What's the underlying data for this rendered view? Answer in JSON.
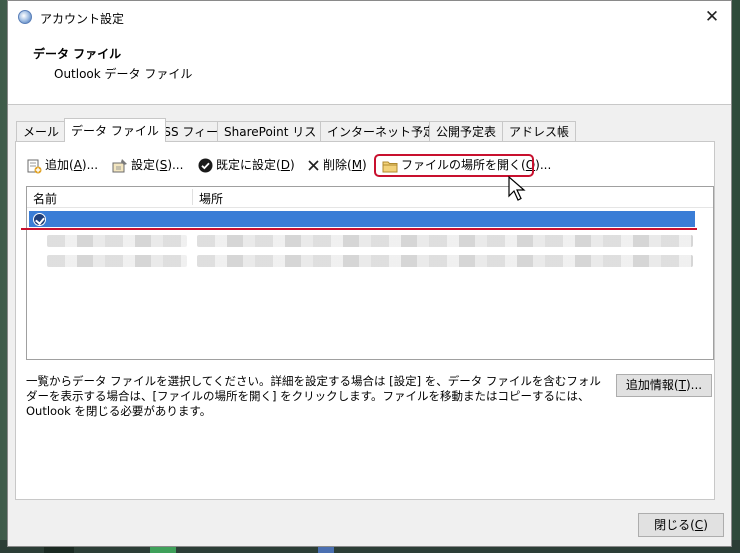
{
  "window": {
    "title": "アカウント設定",
    "close_glyph": "✕"
  },
  "header": {
    "title": "データ ファイル",
    "subtitle": "Outlook データ ファイル"
  },
  "tabs": [
    {
      "label": "メール",
      "active": false
    },
    {
      "label": "データ ファイル",
      "active": true
    },
    {
      "label": "RSS フィード",
      "active": false
    },
    {
      "label": "SharePoint リスト",
      "active": false
    },
    {
      "label": "インターネット予定表",
      "active": false
    },
    {
      "label": "公開予定表",
      "active": false
    },
    {
      "label": "アドレス帳",
      "active": false
    }
  ],
  "toolbar": {
    "add": {
      "pre": "追加(",
      "key": "A",
      "post": ")..."
    },
    "settings": {
      "pre": "設定(",
      "key": "S",
      "post": ")..."
    },
    "default": {
      "pre": "既定に設定(",
      "key": "D",
      "post": ")"
    },
    "delete": {
      "pre": "削除(",
      "key": "M",
      "post": ")"
    },
    "open_location": {
      "pre": "ファイルの場所を開く(",
      "key": "O",
      "post": ")..."
    }
  },
  "list": {
    "columns": [
      "名前",
      "場所"
    ]
  },
  "description": "一覧からデータ ファイルを選択してください。詳細を設定する場合は [設定] を、データ ファイルを含むフォルダーを表示する場合は、[ファイルの場所を開く] をクリックします。ファイルを移動またはコピーするには、Outlook を閉じる必要があります。",
  "more_info": {
    "pre": "追加情報(",
    "key": "T",
    "post": ")..."
  },
  "close_button": {
    "pre": "閉じる(",
    "key": "C",
    "post": ")"
  },
  "colors": {
    "selection": "#3a7dd6",
    "highlight": "#c8102e"
  }
}
